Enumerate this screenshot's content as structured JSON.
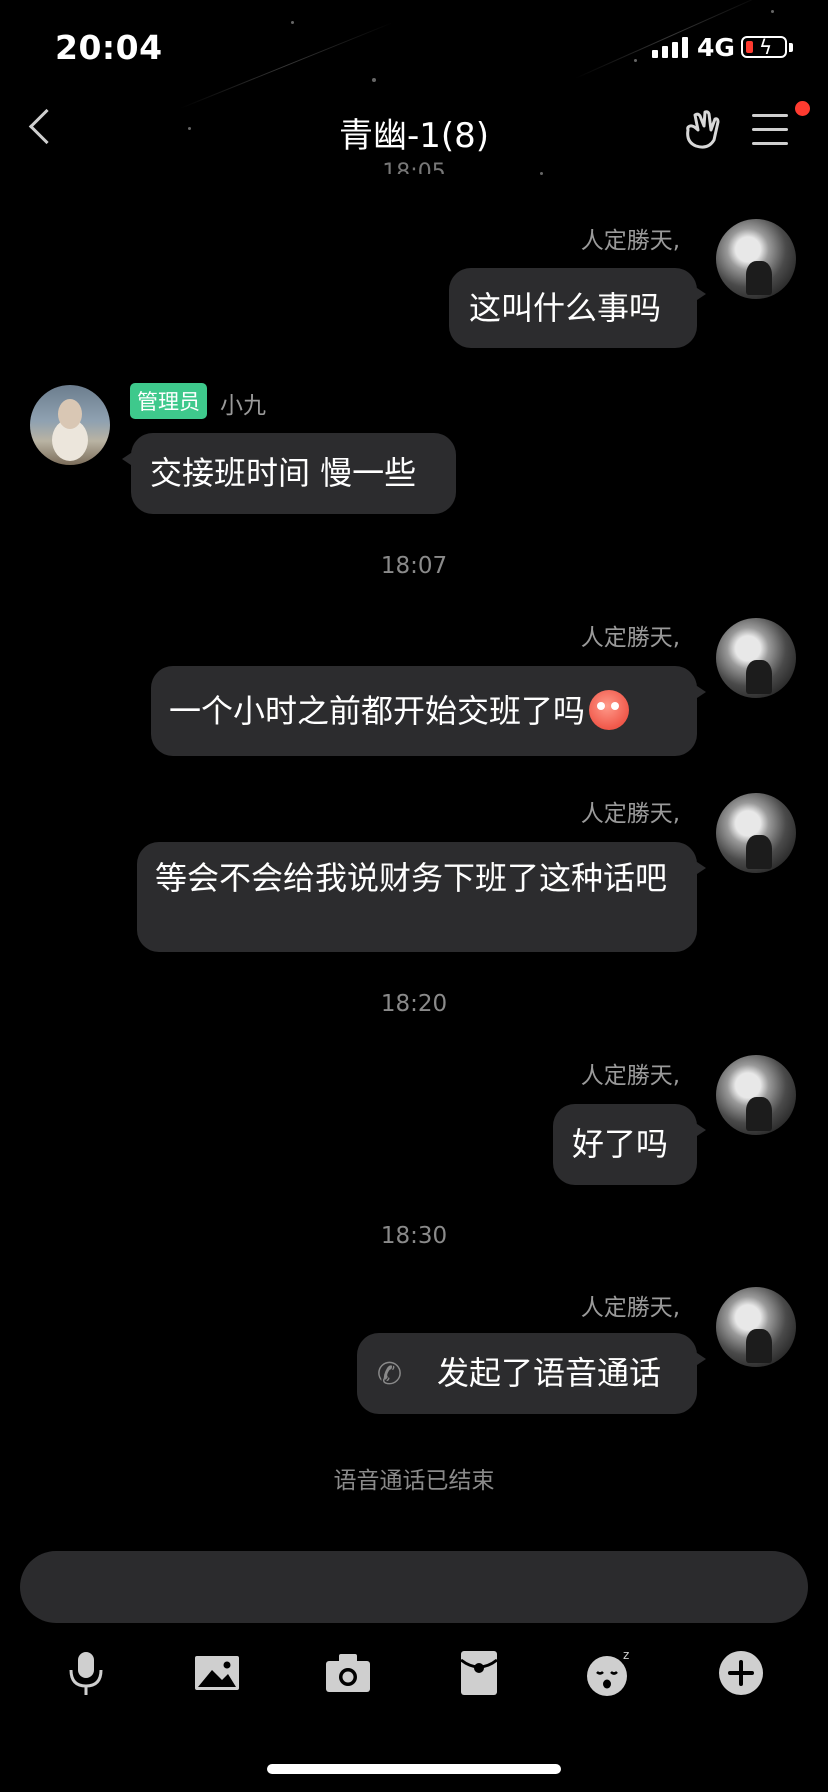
{
  "status_bar": {
    "time": "20:04",
    "network": "4G"
  },
  "header": {
    "title": "青幽-1(8)",
    "cut_time": "18:05"
  },
  "chat": {
    "my_name": "人定勝天,",
    "admin_badge": "管理员",
    "other_name": "小九",
    "messages": [
      {
        "text": "这叫什么事吗"
      },
      {
        "text": "交接班时间 慢一些"
      },
      {
        "text": "一个小时之前都开始交班了吗"
      },
      {
        "text": "等会不会给我说财务下班了这种话吧"
      },
      {
        "text": "好了吗"
      },
      {
        "text": "发起了语音通话"
      }
    ],
    "time_separators": [
      "18:07",
      "18:20",
      "18:30"
    ],
    "system_note": "语音通话已结束"
  },
  "toolbar": {
    "icons": [
      "microphone-icon",
      "image-icon",
      "camera-icon",
      "red-packet-icon",
      "sticker-icon",
      "plus-icon"
    ]
  },
  "colors": {
    "background": "#000000",
    "bubble": "#2c2c2e",
    "admin_badge": "#3ec98c",
    "notification_dot": "#ff3b30"
  }
}
